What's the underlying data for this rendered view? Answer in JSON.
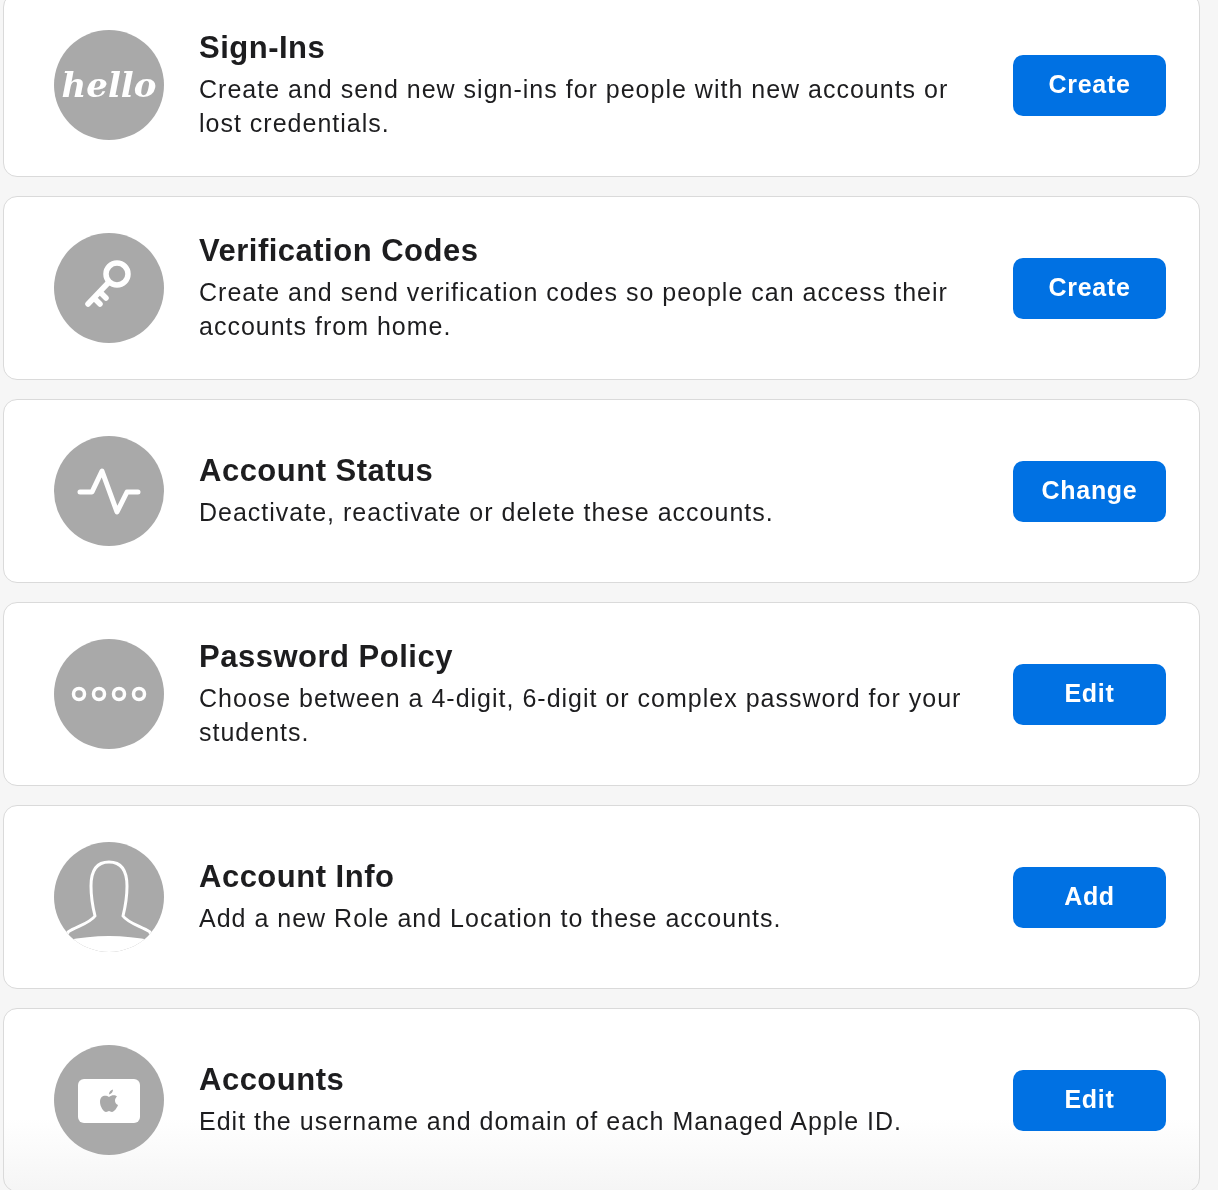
{
  "items": [
    {
      "icon_text": "hello",
      "title": "Sign-Ins",
      "description": "Create and send new sign-ins for people with new accounts or lost credentials.",
      "button": "Create"
    },
    {
      "title": "Verification Codes",
      "description": "Create and send verification codes so people can access their accounts from home.",
      "button": "Create"
    },
    {
      "title": "Account Status",
      "description": "Deactivate, reactivate or delete these accounts.",
      "button": "Change"
    },
    {
      "title": "Password Policy",
      "description": "Choose between a 4-digit, 6-digit or complex password for your students.",
      "button": "Edit"
    },
    {
      "title": "Account Info",
      "description": "Add a new Role and Location to these accounts.",
      "button": "Add"
    },
    {
      "title": "Accounts",
      "description": "Edit the username and domain of each Managed Apple ID.",
      "button": "Edit"
    }
  ]
}
